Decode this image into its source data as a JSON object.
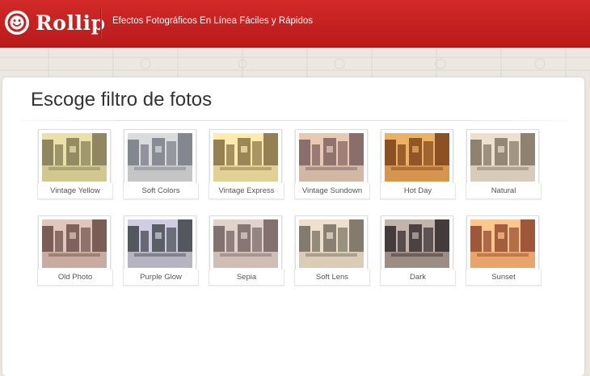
{
  "header": {
    "logo_text": "Rollip",
    "tagline": "Efectos Fotográficos En Línea Fáciles y Rápidos"
  },
  "page": {
    "title": "Escoge filtro de fotos"
  },
  "filters": [
    {
      "label": "Vintage Yellow",
      "colors": {
        "sky": "#ece6c2",
        "build": "#6d6a5a",
        "street": "#c9c2a0",
        "tint": "#e7d36a"
      }
    },
    {
      "label": "Soft Colors",
      "colors": {
        "sky": "#e7e4de",
        "build": "#6f6f74",
        "street": "#c9c6bf",
        "tint": "#b7c7d6"
      }
    },
    {
      "label": "Vintage Express",
      "colors": {
        "sky": "#fff3c4",
        "build": "#6b5f4a",
        "street": "#d7cda4",
        "tint": "#ffd96a"
      }
    },
    {
      "label": "Vintage Sundown",
      "colors": {
        "sky": "#efd8c4",
        "build": "#6a5a5f",
        "street": "#cdbfb0",
        "tint": "#e0a28a"
      }
    },
    {
      "label": "Hot Day",
      "colors": {
        "sky": "#f2c27a",
        "build": "#6b3e1e",
        "street": "#d49a5c",
        "tint": "#e0852d"
      }
    },
    {
      "label": "Natural",
      "colors": {
        "sky": "#f0ece4",
        "build": "#6e6a60",
        "street": "#d2cfc6",
        "tint": "#e7c39a"
      }
    },
    {
      "label": "Old Photo",
      "colors": {
        "sky": "#ead7cf",
        "build": "#5e4640",
        "street": "#cbb3a9",
        "tint": "#c79b8c"
      }
    },
    {
      "label": "Purple Glow",
      "colors": {
        "sky": "#eceaf4",
        "build": "#3f4a3f",
        "street": "#c9c9c9",
        "tint": "#8a7fb0"
      }
    },
    {
      "label": "Sepia",
      "colors": {
        "sky": "#efe4dc",
        "build": "#6c5c5c",
        "street": "#d4c7bd",
        "tint": "#bfa8a0"
      }
    },
    {
      "label": "Soft Lens",
      "colors": {
        "sky": "#f3e9dc",
        "build": "#5f5e56",
        "street": "#d7cdbc",
        "tint": "#e2c8a8"
      }
    },
    {
      "label": "Dark",
      "colors": {
        "sky": "#e0d7d0",
        "build": "#2f3036",
        "street": "#a9a19c",
        "tint": "#7a5a4a"
      }
    },
    {
      "label": "Sunset",
      "colors": {
        "sky": "#ffd9a6",
        "build": "#7a3e32",
        "street": "#e0a878",
        "tint": "#ff9a4a"
      }
    }
  ]
}
